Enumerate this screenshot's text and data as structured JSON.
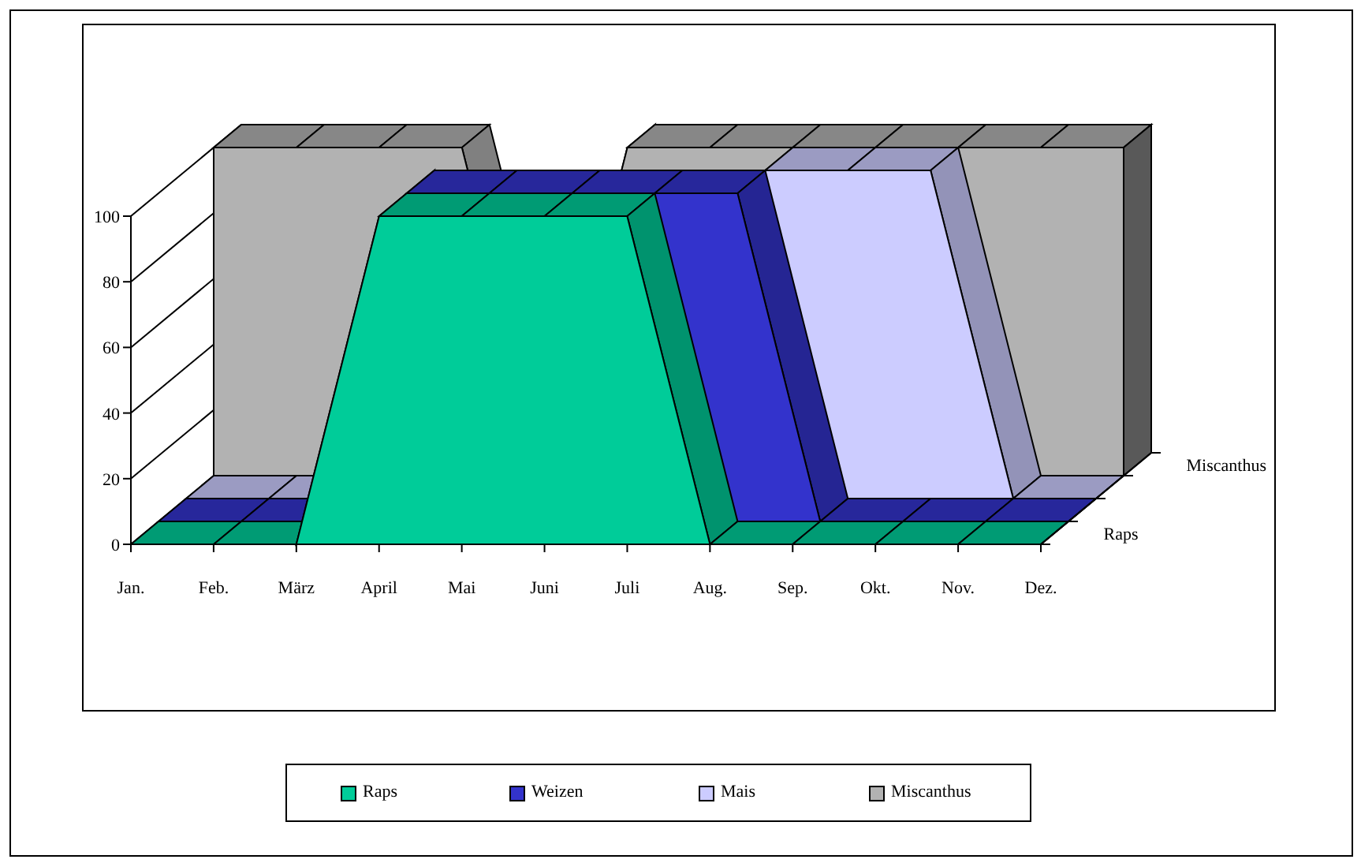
{
  "chart": {
    "y_axis_labels": [
      "100",
      "80",
      "60",
      "40",
      "20",
      "0"
    ],
    "x_axis_labels": [
      "Jan.",
      "Feb.",
      "März",
      "April",
      "Mai",
      "Juni",
      "Juli",
      "Aug.",
      "Sep.",
      "Okt.",
      "Nov.",
      "Dez."
    ],
    "depth_axis_labels": [
      "Raps",
      "Miscanthus"
    ],
    "legend": [
      {
        "label": "Raps",
        "color": "#00cc99"
      },
      {
        "label": "Weizen",
        "color": "#3333cc"
      },
      {
        "label": "Mais",
        "color": "#ccccff"
      },
      {
        "label": "Miscanthus",
        "color": "#b2b2b2"
      }
    ]
  }
}
